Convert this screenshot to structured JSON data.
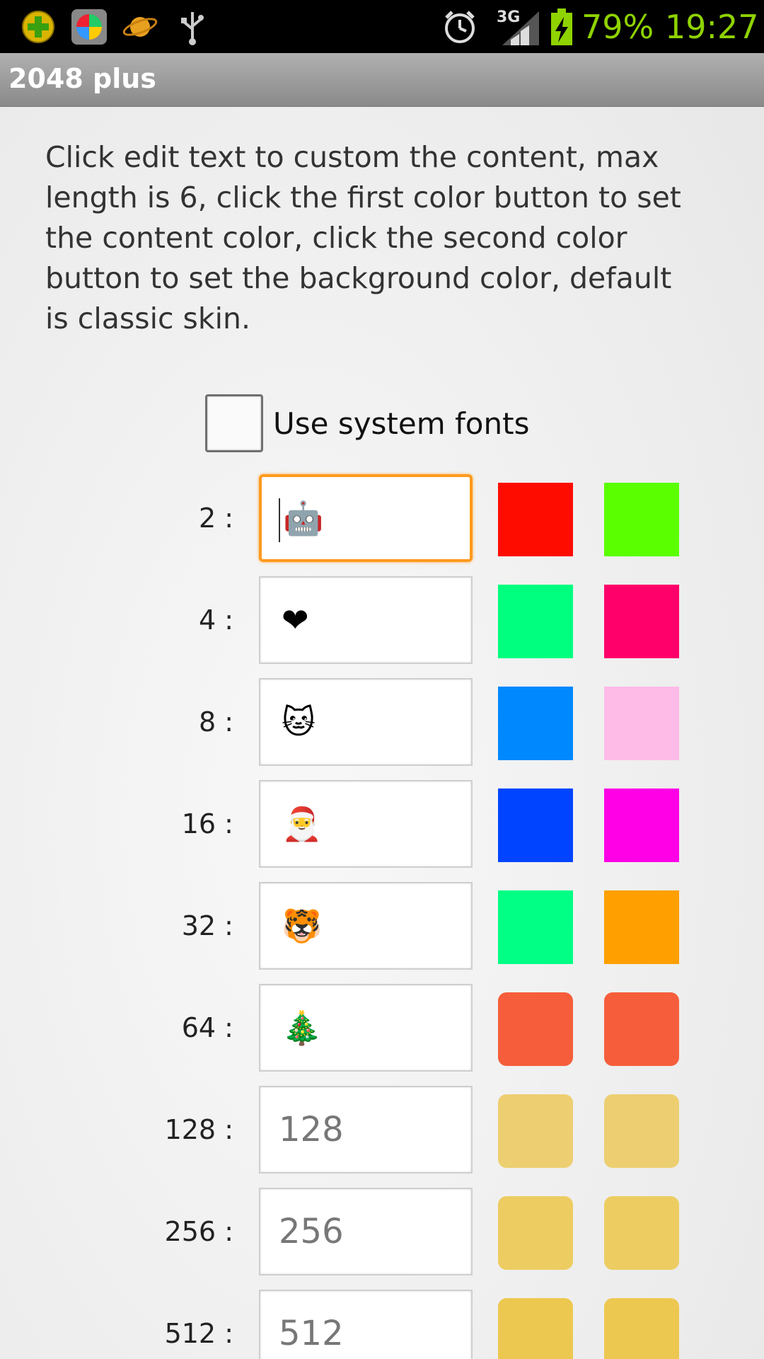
{
  "status_bar": {
    "icons_left": [
      "plus-badge-icon",
      "beach-ball-app-icon",
      "planet-icon",
      "usb-icon"
    ],
    "icons_right": [
      "alarm-icon",
      "network-3g-icon",
      "battery-charging-icon"
    ],
    "network_label": "3G",
    "battery": "79%",
    "time": "19:27"
  },
  "app": {
    "title": "2048 plus"
  },
  "instructions": "Click edit text to custom the content, max length is 6, click the first color button to set the content color, click the second color button to set the background color, default is classic skin.",
  "system_fonts": {
    "label": "Use system fonts",
    "checked": false
  },
  "tiles": [
    {
      "label": "2 :",
      "value": "🤖",
      "icon": "android-robot-icon",
      "text_color": "#ff0c00",
      "bg_color": "#5aff00",
      "placeholder": false,
      "focused": true
    },
    {
      "label": "4 :",
      "value": "❤",
      "icon": "heart-icon",
      "text_color": "#00ff7f",
      "bg_color": "#ff006a",
      "placeholder": false,
      "focused": false
    },
    {
      "label": "8 :",
      "value": "🐱",
      "icon": "cat-icon",
      "text_color": "#0088ff",
      "bg_color": "#ffbbe8",
      "placeholder": false,
      "focused": false
    },
    {
      "label": "16 :",
      "value": "🎅",
      "icon": "santa-icon",
      "text_color": "#0044ff",
      "bg_color": "#ff00e6",
      "placeholder": false,
      "focused": false
    },
    {
      "label": "32 :",
      "value": "🐯",
      "icon": "tiger-icon",
      "text_color": "#00ff84",
      "bg_color": "#ff9f00",
      "placeholder": false,
      "focused": false
    },
    {
      "label": "64 :",
      "value": "🎄",
      "icon": "christmas-tree-icon",
      "text_color": "#f65e3b",
      "bg_color": "#f65e3b",
      "placeholder": false,
      "focused": false
    },
    {
      "label": "128 :",
      "value": "128",
      "icon": "",
      "text_color": "#edcf72",
      "bg_color": "#edcf72",
      "placeholder": true,
      "focused": false
    },
    {
      "label": "256 :",
      "value": "256",
      "icon": "",
      "text_color": "#edcc61",
      "bg_color": "#edcc61",
      "placeholder": true,
      "focused": false
    },
    {
      "label": "512 :",
      "value": "512",
      "icon": "",
      "text_color": "#edc850",
      "bg_color": "#edc850",
      "placeholder": true,
      "focused": false
    }
  ]
}
